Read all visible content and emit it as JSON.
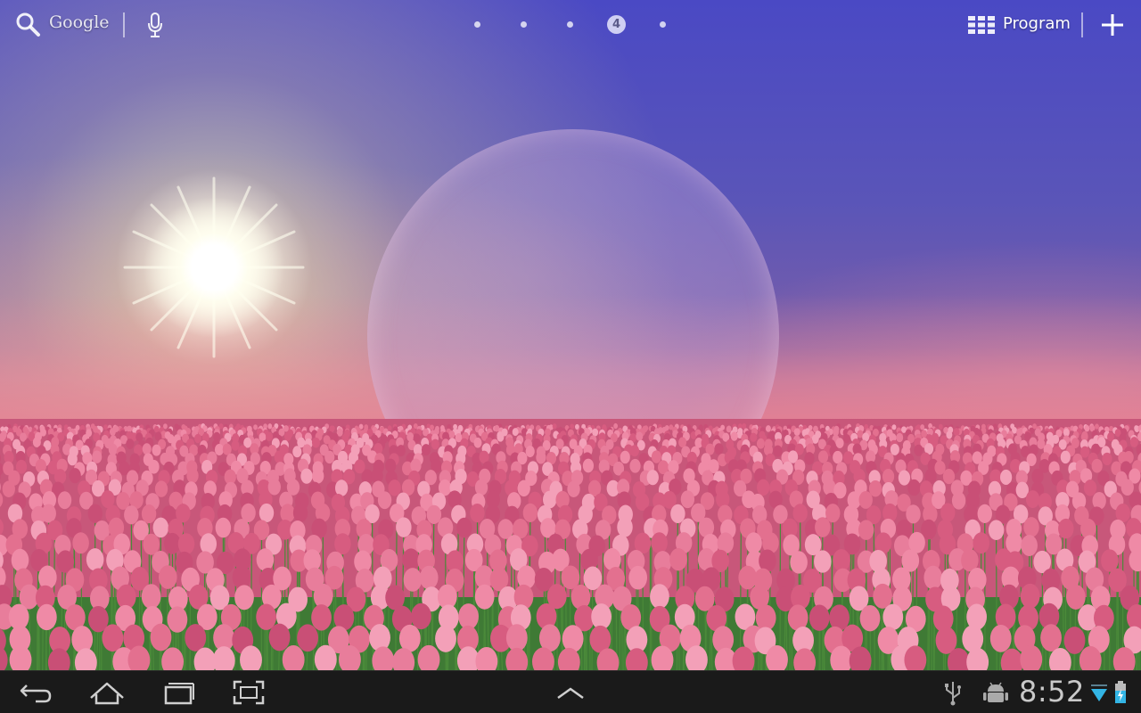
{
  "top_bar": {
    "search_label": "Google",
    "page_indicator": {
      "page_count": 5,
      "current_page": 4,
      "current_label": "4"
    },
    "apps_label": "Program"
  },
  "system_bar": {
    "clock": "8:52"
  },
  "colors": {
    "system_bar_bg": "#1a1a1a",
    "sky_top": "#4a49c4",
    "tulip_pink": "#e3708f",
    "wifi_icon": "#33b5e5",
    "battery_icon": "#33b5e5"
  }
}
